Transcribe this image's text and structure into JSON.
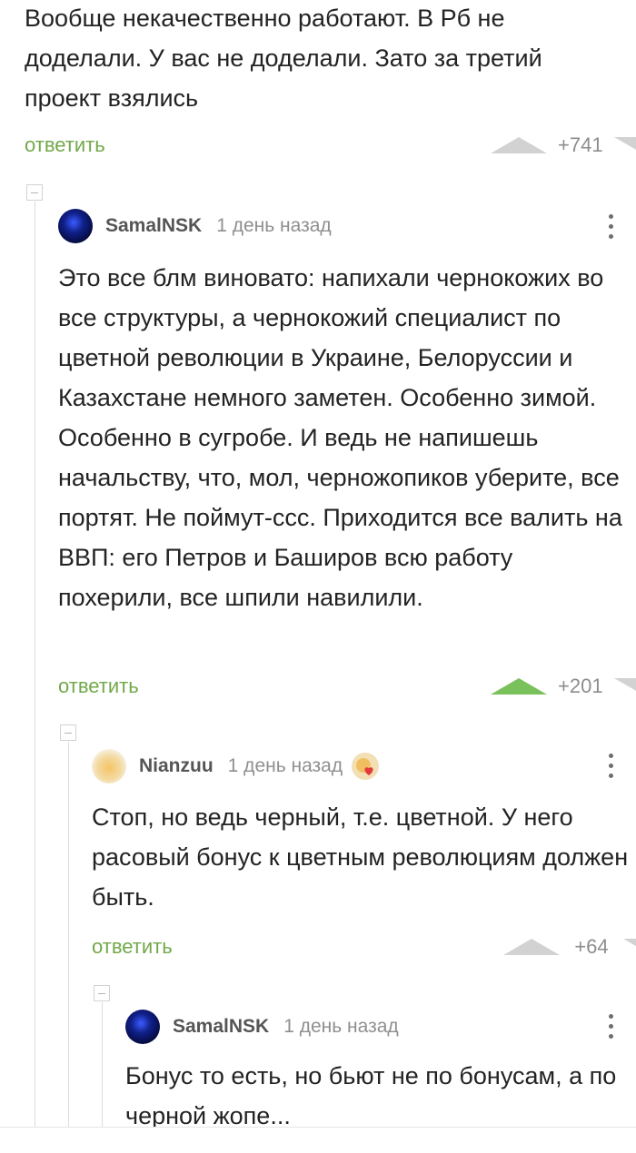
{
  "comments": [
    {
      "text": "Вообще некачественно работают. В Рб не доделали. У вас не доделали. Зато за третий проект взялись",
      "reply_label": "ответить",
      "votes": "+741",
      "upvoted": false
    },
    {
      "username": "SamalNSK",
      "time": "1 день назад",
      "text": "Это все блм виновато: напихали чернокожих во все структуры, а чернокожий специалист по цветной революции в Украине, Белоруссии и Казахстане немного заметен. Особенно зимой. Особенно в сугробе. И ведь не напишешь начальству, что, мол, черножопиков уберите, все портят. Не поймут-ссс. Приходится все валить на ВВП: его Петров и Баширов всю работу похерили, все шпили навилили.",
      "reply_label": "ответить",
      "votes": "+201",
      "upvoted": true
    },
    {
      "username": "Nianzuu",
      "time": "1 день назад",
      "text": "Стоп, но ведь черный, т.е. цветной. У него расовый бонус к цветным революциям должен быть.",
      "reply_label": "ответить",
      "votes": "+64",
      "upvoted": false
    },
    {
      "username": "SamalNSK",
      "time": "1 день назад",
      "text": "Бонус то есть, но бьют не по бонусам, а по черной жопе..."
    }
  ],
  "colors": {
    "reply": "#72a84a",
    "upvote_active": "#79c15a",
    "vote_inactive": "#d2d2d2"
  },
  "icons": {
    "more": "vertical-dots-icon",
    "upvote": "triangle-up-icon",
    "downvote": "triangle-down-icon",
    "collapse": "minus-square-icon"
  }
}
